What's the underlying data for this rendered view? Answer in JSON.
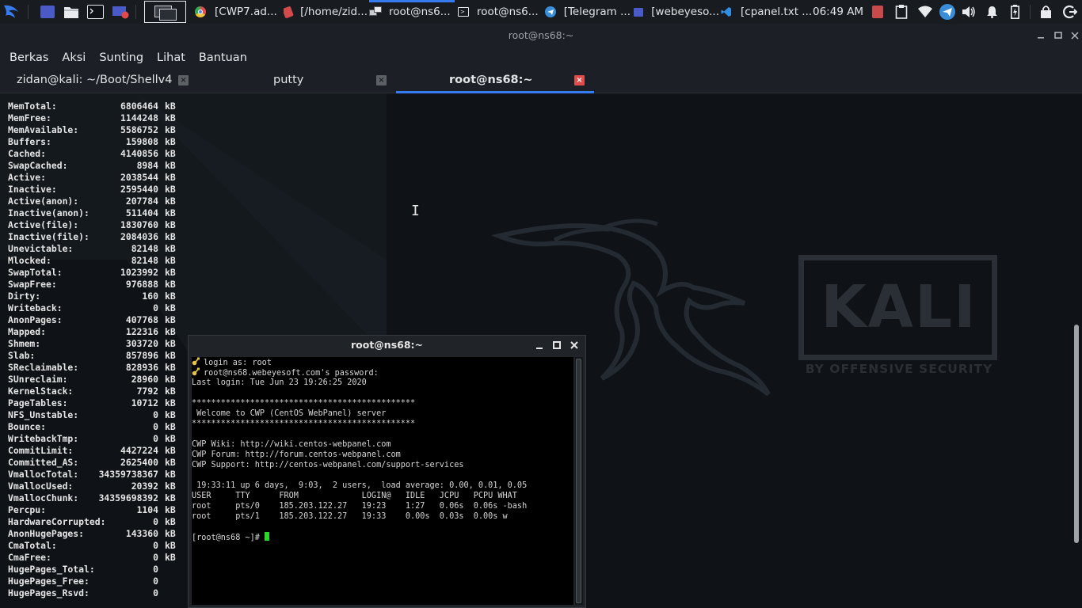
{
  "panel": {
    "items": [
      {
        "name": "[CWP7.ad...",
        "icon": "chrome-icon"
      },
      {
        "name": "[/home/zid...",
        "icon": "file-manager-icon"
      },
      {
        "name": "root@ns6...",
        "icon": "putty-icon"
      },
      {
        "name": "root@ns6...",
        "icon": "terminal-icon"
      },
      {
        "name": "[Telegram ...",
        "icon": "telegram-icon"
      },
      {
        "name": "[webeyeso...",
        "icon": "folder-icon"
      },
      {
        "name": "[cpanel.txt ...",
        "icon": "vscode-icon"
      }
    ],
    "clock": "06:49 AM",
    "accent": "#367bf0"
  },
  "window": {
    "title": "root@ns68:~"
  },
  "menu": [
    "Berkas",
    "Aksi",
    "Sunting",
    "Lihat",
    "Bantuan"
  ],
  "tabs": [
    {
      "label": "zidan@kali: ~/Boot/Shellv4",
      "active": false
    },
    {
      "label": "putty",
      "active": false
    },
    {
      "label": "root@ns68:~",
      "active": true
    }
  ],
  "meminfo": [
    {
      "key": "MemTotal:",
      "value": "6806464",
      "unit": "kB"
    },
    {
      "key": "MemFree:",
      "value": "1144248",
      "unit": "kB"
    },
    {
      "key": "MemAvailable:",
      "value": "5586752",
      "unit": "kB"
    },
    {
      "key": "Buffers:",
      "value": "159808",
      "unit": "kB"
    },
    {
      "key": "Cached:",
      "value": "4140856",
      "unit": "kB"
    },
    {
      "key": "SwapCached:",
      "value": "8984",
      "unit": "kB"
    },
    {
      "key": "Active:",
      "value": "2038544",
      "unit": "kB"
    },
    {
      "key": "Inactive:",
      "value": "2595440",
      "unit": "kB"
    },
    {
      "key": "Active(anon):",
      "value": "207784",
      "unit": "kB"
    },
    {
      "key": "Inactive(anon):",
      "value": "511404",
      "unit": "kB"
    },
    {
      "key": "Active(file):",
      "value": "1830760",
      "unit": "kB"
    },
    {
      "key": "Inactive(file):",
      "value": "2084036",
      "unit": "kB"
    },
    {
      "key": "Unevictable:",
      "value": "82148",
      "unit": "kB"
    },
    {
      "key": "Mlocked:",
      "value": "82148",
      "unit": "kB"
    },
    {
      "key": "SwapTotal:",
      "value": "1023992",
      "unit": "kB"
    },
    {
      "key": "SwapFree:",
      "value": "976888",
      "unit": "kB"
    },
    {
      "key": "Dirty:",
      "value": "160",
      "unit": "kB"
    },
    {
      "key": "Writeback:",
      "value": "0",
      "unit": "kB"
    },
    {
      "key": "AnonPages:",
      "value": "407768",
      "unit": "kB"
    },
    {
      "key": "Mapped:",
      "value": "122316",
      "unit": "kB"
    },
    {
      "key": "Shmem:",
      "value": "303720",
      "unit": "kB"
    },
    {
      "key": "Slab:",
      "value": "857896",
      "unit": "kB"
    },
    {
      "key": "SReclaimable:",
      "value": "828936",
      "unit": "kB"
    },
    {
      "key": "SUnreclaim:",
      "value": "28960",
      "unit": "kB"
    },
    {
      "key": "KernelStack:",
      "value": "7792",
      "unit": "kB"
    },
    {
      "key": "PageTables:",
      "value": "10712",
      "unit": "kB"
    },
    {
      "key": "NFS_Unstable:",
      "value": "0",
      "unit": "kB"
    },
    {
      "key": "Bounce:",
      "value": "0",
      "unit": "kB"
    },
    {
      "key": "WritebackTmp:",
      "value": "0",
      "unit": "kB"
    },
    {
      "key": "CommitLimit:",
      "value": "4427224",
      "unit": "kB"
    },
    {
      "key": "Committed_AS:",
      "value": "2625400",
      "unit": "kB"
    },
    {
      "key": "VmallocTotal:",
      "value": "34359738367",
      "unit": "kB"
    },
    {
      "key": "VmallocUsed:",
      "value": "20392",
      "unit": "kB"
    },
    {
      "key": "VmallocChunk:",
      "value": "34359698392",
      "unit": "kB"
    },
    {
      "key": "Percpu:",
      "value": "1104",
      "unit": "kB"
    },
    {
      "key": "HardwareCorrupted:",
      "value": "0",
      "unit": "kB"
    },
    {
      "key": "AnonHugePages:",
      "value": "143360",
      "unit": "kB"
    },
    {
      "key": "CmaTotal:",
      "value": "0",
      "unit": "kB"
    },
    {
      "key": "CmaFree:",
      "value": "0",
      "unit": "kB"
    },
    {
      "key": "HugePages_Total:",
      "value": "0",
      "unit": ""
    },
    {
      "key": "HugePages_Free:",
      "value": "0",
      "unit": ""
    },
    {
      "key": "HugePages_Rsvd:",
      "value": "0",
      "unit": ""
    }
  ],
  "watermark": {
    "logo": "KALI",
    "tagline": "BY OFFENSIVE SECURITY"
  },
  "putty": {
    "title": "root@ns68:~",
    "lines": [
      {
        "text": "login as: root",
        "key": true
      },
      {
        "text": "root@ns68.webeyesoft.com's password:",
        "key": true
      },
      {
        "text": "Last login: Tue Jun 23 19:26:25 2020"
      },
      {
        "text": ""
      },
      {
        "text": "**********************************************"
      },
      {
        "text": " Welcome to CWP (CentOS WebPanel) server"
      },
      {
        "text": "**********************************************"
      },
      {
        "text": ""
      },
      {
        "text": "CWP Wiki: http://wiki.centos-webpanel.com"
      },
      {
        "text": "CWP Forum: http://forum.centos-webpanel.com"
      },
      {
        "text": "CWP Support: http://centos-webpanel.com/support-services"
      },
      {
        "text": ""
      },
      {
        "text": " 19:33:11 up 6 days,  9:03,  2 users,  load average: 0.00, 0.01, 0.05"
      },
      {
        "text": "USER     TTY      FROM             LOGIN@   IDLE   JCPU   PCPU WHAT"
      },
      {
        "text": "root     pts/0    185.203.122.27   19:23    1:27   0.06s  0.06s -bash"
      },
      {
        "text": "root     pts/1    185.203.122.27   19:33    0.00s  0.03s  0.00s w"
      },
      {
        "text": ""
      },
      {
        "text": "[root@ns68 ~]# ",
        "cursor": true
      }
    ]
  }
}
